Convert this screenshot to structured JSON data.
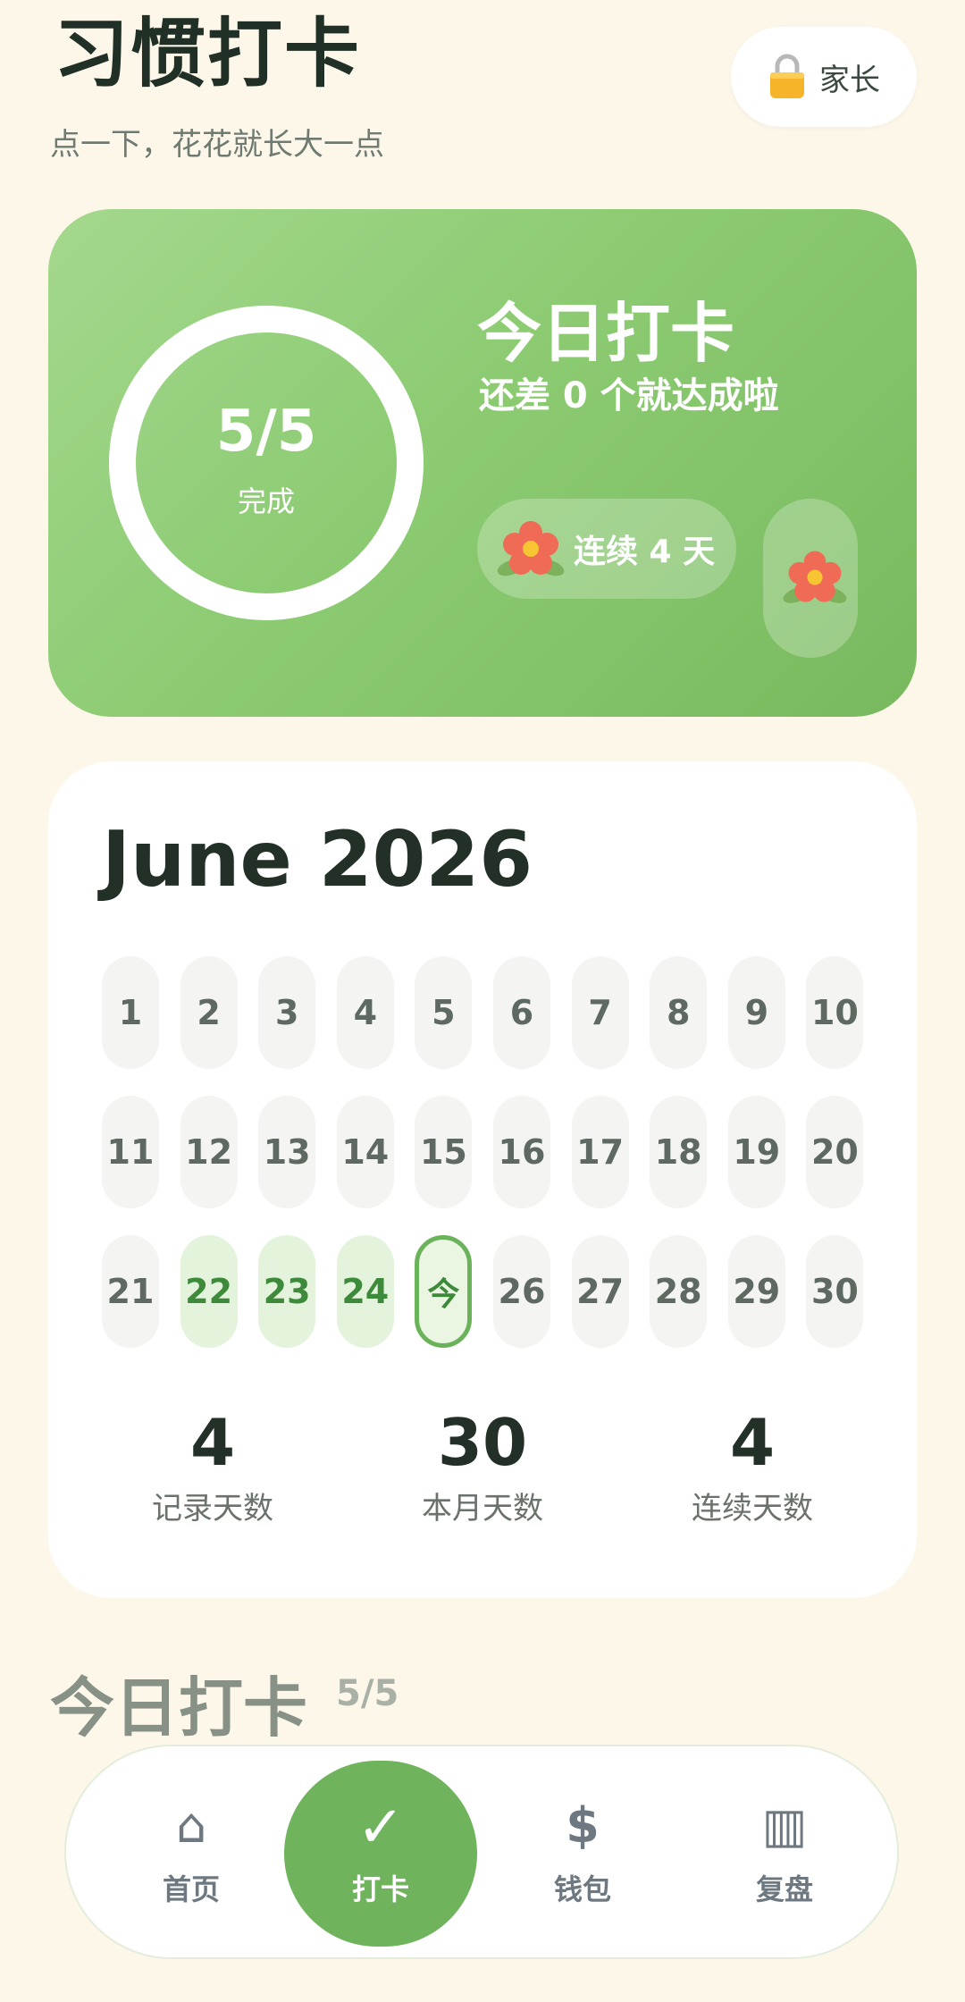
{
  "header": {
    "title": "习惯打卡",
    "subtitle": "点一下，花花就长大一点",
    "parent_button": {
      "label": "家长",
      "icon": "lock-icon"
    }
  },
  "hero": {
    "progress": {
      "done": 5,
      "total": 5,
      "text": "5/5",
      "label": "完成"
    },
    "title": "今日打卡",
    "subtitle": "还差 0 个就达成啦",
    "streak_label": "连续 4 天",
    "flower_icon": "flower-icon"
  },
  "calendar": {
    "title": "June 2026",
    "days": [
      {
        "label": "1",
        "state": "empty"
      },
      {
        "label": "2",
        "state": "empty"
      },
      {
        "label": "3",
        "state": "empty"
      },
      {
        "label": "4",
        "state": "empty"
      },
      {
        "label": "5",
        "state": "empty"
      },
      {
        "label": "6",
        "state": "empty"
      },
      {
        "label": "7",
        "state": "empty"
      },
      {
        "label": "8",
        "state": "empty"
      },
      {
        "label": "9",
        "state": "empty"
      },
      {
        "label": "10",
        "state": "empty"
      },
      {
        "label": "11",
        "state": "empty"
      },
      {
        "label": "12",
        "state": "empty"
      },
      {
        "label": "13",
        "state": "empty"
      },
      {
        "label": "14",
        "state": "empty"
      },
      {
        "label": "15",
        "state": "empty"
      },
      {
        "label": "16",
        "state": "empty"
      },
      {
        "label": "17",
        "state": "empty"
      },
      {
        "label": "18",
        "state": "empty"
      },
      {
        "label": "19",
        "state": "empty"
      },
      {
        "label": "20",
        "state": "empty"
      },
      {
        "label": "21",
        "state": "empty"
      },
      {
        "label": "22",
        "state": "done"
      },
      {
        "label": "23",
        "state": "done"
      },
      {
        "label": "24",
        "state": "done"
      },
      {
        "label": "今",
        "state": "today"
      },
      {
        "label": "26",
        "state": "empty"
      },
      {
        "label": "27",
        "state": "empty"
      },
      {
        "label": "28",
        "state": "empty"
      },
      {
        "label": "29",
        "state": "empty"
      },
      {
        "label": "30",
        "state": "empty"
      }
    ],
    "stats": [
      {
        "value": "4",
        "label": "记录天数"
      },
      {
        "value": "30",
        "label": "本月天数"
      },
      {
        "value": "4",
        "label": "连续天数"
      }
    ]
  },
  "section": {
    "title": "今日打卡",
    "count": "5/5"
  },
  "nav": {
    "items": [
      {
        "label": "首页",
        "icon": "home-icon",
        "glyph": "⌂"
      },
      {
        "label": "打卡",
        "icon": "check-icon",
        "glyph": "✓",
        "active": true
      },
      {
        "label": "钱包",
        "icon": "dollar-icon",
        "glyph": "$"
      },
      {
        "label": "复盘",
        "icon": "review-icon",
        "glyph": "▥"
      }
    ]
  },
  "colors": {
    "accent": "#6fb35c",
    "background": "#fdf7ea",
    "done_day": "#e3f3dc"
  }
}
